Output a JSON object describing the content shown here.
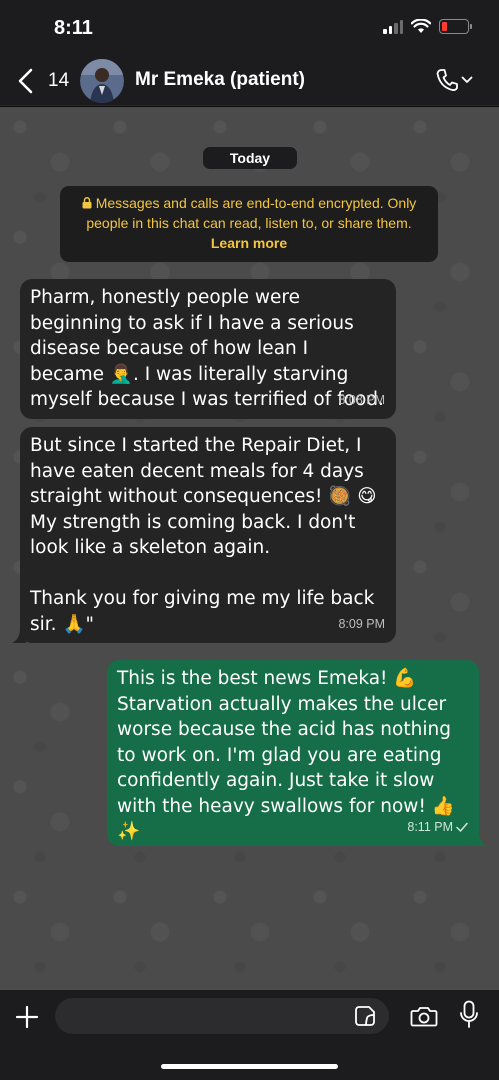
{
  "status_bar": {
    "time": "8:11"
  },
  "header": {
    "back_count": "14",
    "contact_name": "Mr Emeka (patient)"
  },
  "chat": {
    "date_label": "Today",
    "encryption_text": "Messages and calls are end-to-end encrypted. Only people in this chat can read, listen to, or share them.",
    "encryption_link": "Learn more",
    "messages": [
      {
        "direction": "incoming",
        "text": "Pharm, honestly people were beginning to ask if I have a serious disease because of how lean I became 🤦‍♂️. I was literally starving myself because I was terrified of food.",
        "time": "8:08 PM"
      },
      {
        "direction": "incoming",
        "text": "But since I started the Repair Diet, I have eaten decent meals for 4 days straight without consequences! 🥘 😋\nMy strength is coming back. I don't look like a skeleton again.\n\nThank you for giving me my life back sir. 🙏\"",
        "time": "8:09 PM"
      },
      {
        "direction": "outgoing",
        "text": "This is the best news Emeka! 💪\nStarvation actually makes the ulcer worse because the acid has nothing to work on. I'm glad you are eating confidently again. Just take it slow with the heavy swallows for now! 👍✨",
        "time": "8:11 PM",
        "status": "sent"
      }
    ]
  },
  "input": {
    "placeholder": ""
  },
  "colors": {
    "incoming_bubble": "#242424",
    "outgoing_bubble": "#156e47",
    "chat_background": "#4b4b4b",
    "encryption_text": "#f4c542"
  }
}
